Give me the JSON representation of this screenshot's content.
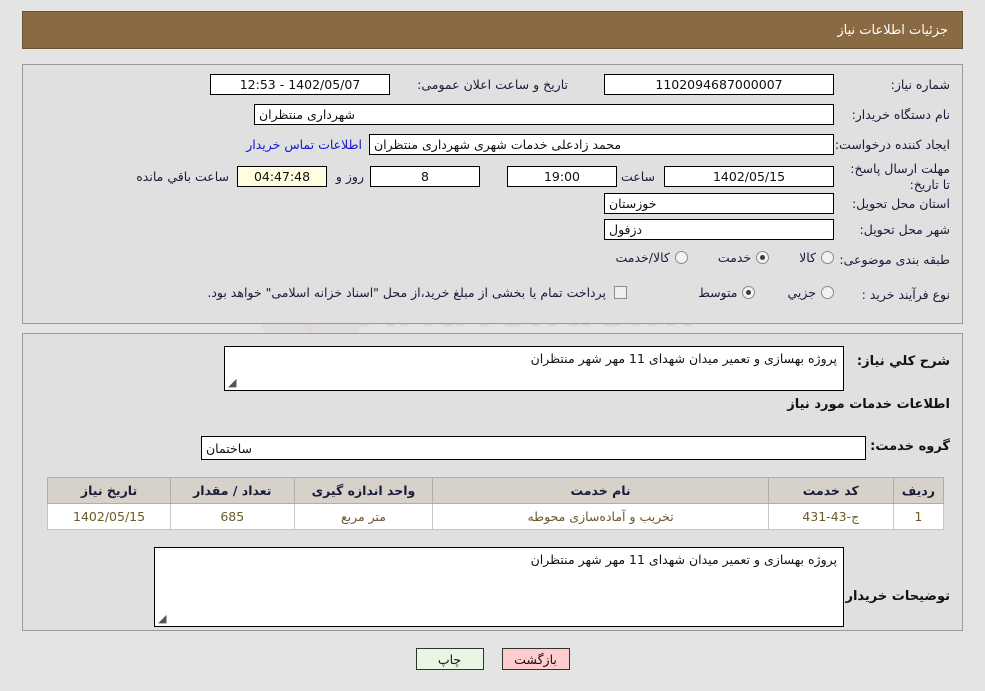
{
  "header": {
    "title": "جزئیات اطلاعات نیاز"
  },
  "watermark": {
    "text": "AriaTender.ir"
  },
  "top_section": {
    "need_number": {
      "label": "شماره نیاز:",
      "value": "1102094687000007"
    },
    "buyer_org": {
      "label": "نام دستگاه خریدار:",
      "value": "شهرداری منتظران"
    },
    "request_creator": {
      "label": "ایجاد کننده درخواست:",
      "value": "محمد زادعلی خدمات شهری  شهرداری منتظران"
    },
    "contact_link": {
      "label": "اطلاعات تماس خریدار"
    },
    "announcement_datetime": {
      "label": "تاریخ و ساعت اعلان عمومی:",
      "value": "1402/05/07 - 12:53"
    },
    "deadline": {
      "label": "مهلت ارسال پاسخ: تا تاریخ:",
      "date": "1402/05/15",
      "time_label": "ساعت",
      "time": "19:00",
      "days": "8",
      "days_label": "روز و",
      "countdown": "04:47:48",
      "countdown_label": "ساعت باقي مانده"
    },
    "delivery_province": {
      "label": "استان محل تحویل:",
      "value": "خوزستان"
    },
    "delivery_city": {
      "label": "شهر محل تحویل:",
      "value": "دزفول"
    },
    "subject_category": {
      "label": "طبقه بندی موضوعی:",
      "options": [
        {
          "label": "کالا",
          "selected": false
        },
        {
          "label": "خدمت",
          "selected": true
        },
        {
          "label": "کالا/خدمت",
          "selected": false
        }
      ]
    },
    "purchase_process": {
      "label": "نوع فرآیند خرید :",
      "options": [
        {
          "label": "جزیي",
          "selected": false
        },
        {
          "label": "متوسط",
          "selected": true
        }
      ],
      "treasury_note": "پرداخت تمام یا بخشی از مبلغ خرید،از محل \"اسناد خزانه اسلامی\" خواهد بود."
    }
  },
  "middle_section": {
    "general_description": {
      "label": "شرح كلي نياز:",
      "value": "پروژه بهسازی و تعمیر میدان شهدای 11 مهر شهر منتظران"
    },
    "services_heading": "اطلاعات خدمات مورد نیاز",
    "service_group": {
      "label": "گروه خدمت:",
      "value": "ساختمان"
    },
    "table": {
      "columns": [
        "ردیف",
        "کد خدمت",
        "نام خدمت",
        "واحد اندازه گیری",
        "تعداد / مقدار",
        "تاریخ نیاز"
      ],
      "rows": [
        {
          "index": "1",
          "service_code": "ج-43-431",
          "service_name": "تخریب و آماده‌سازی محوطه",
          "unit": "متر مربع",
          "quantity": "685",
          "need_date": "1402/05/15"
        }
      ]
    },
    "buyer_notes": {
      "label": "توضیحات خریدار:",
      "value": "پروژه بهسازی و تعمیر میدان شهدای 11 مهر شهر منتظران"
    }
  },
  "footer": {
    "print_label": "چاپ",
    "back_label": "بازگشت"
  },
  "colors": {
    "header_bg": "#8a6a42",
    "page_bg": "#e4e4e4",
    "panel_bg": "#e0e0e0",
    "link": "#1414d8",
    "print_btn": "#e8f6e4",
    "back_btn": "#ffcdcd",
    "countdown_bg": "#ffffe0"
  }
}
